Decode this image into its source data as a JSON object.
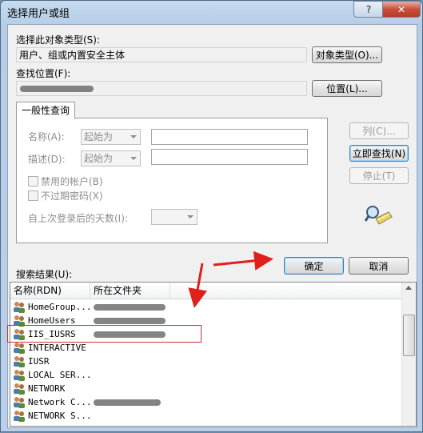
{
  "window": {
    "title": "选择用户或组",
    "help_label": "?",
    "close_label": "✕"
  },
  "object_type": {
    "label": "选择此对象类型(S):",
    "value": "用户、组或内置安全主体",
    "button": "对象类型(O)..."
  },
  "location": {
    "label": "查找位置(F):",
    "value": "",
    "button": "位置(L)..."
  },
  "query": {
    "tab": "一般性查询",
    "name_label": "名称(A):",
    "name_mode": "起始为",
    "desc_label": "描述(D):",
    "desc_mode": "起始为",
    "disabled_accounts": "禁用的帐户(B)",
    "no_expire_pwd": "不过期密码(X)",
    "days_label": "自上次登录后的天数(I):"
  },
  "side_buttons": {
    "columns": "列(C)...",
    "find_now": "立即查找(N)",
    "stop": "停止(T)"
  },
  "actions": {
    "ok": "确定",
    "cancel": "取消"
  },
  "results": {
    "label": "搜索结果(U):",
    "columns": [
      "名称(RDN)",
      "所在文件夹"
    ],
    "rows": [
      {
        "name": "HomeGroup...",
        "folder_redacted": true
      },
      {
        "name": "HomeUsers",
        "folder_redacted": true
      },
      {
        "name": "IIS_IUSRS",
        "folder_redacted": true,
        "highlighted": true
      },
      {
        "name": "INTERACTIVE",
        "folder_redacted": false
      },
      {
        "name": "IUSR",
        "folder_redacted": false
      },
      {
        "name": "LOCAL SER...",
        "folder_redacted": false
      },
      {
        "name": "NETWORK",
        "folder_redacted": false
      },
      {
        "name": "Network C...",
        "folder_redacted": true
      },
      {
        "name": "NETWORK S...",
        "folder_redacted": false
      }
    ]
  },
  "colors": {
    "annotation_red": "#e0201a",
    "title_bar": "#b9d0e8",
    "dialog_bg": "#f0f0f0"
  }
}
